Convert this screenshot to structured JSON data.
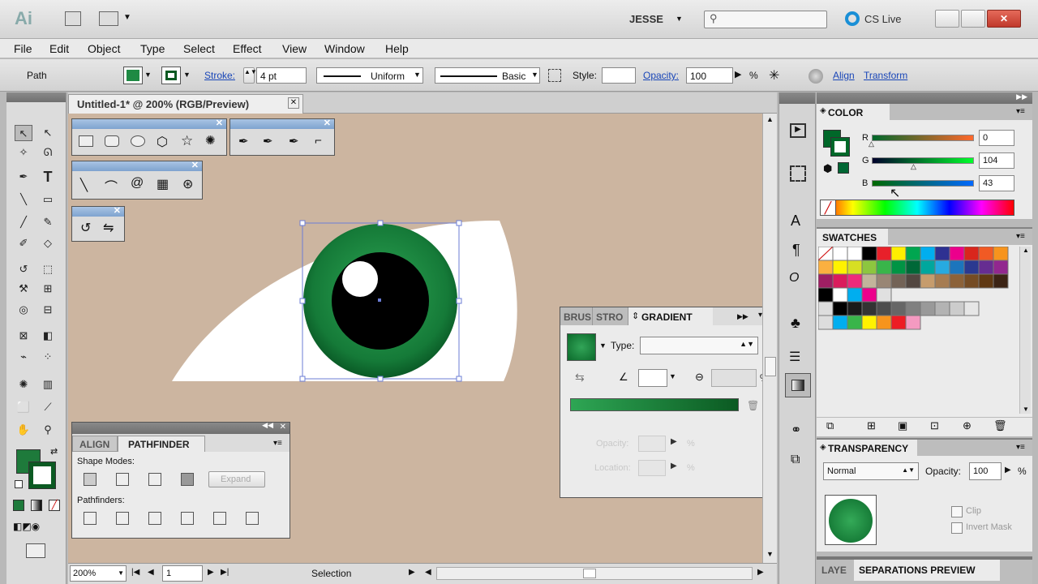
{
  "app": {
    "logo": "Ai",
    "user": "JESSE",
    "search_placeholder": "",
    "cslive": "CS Live"
  },
  "menu": [
    "File",
    "Edit",
    "Object",
    "Type",
    "Select",
    "Effect",
    "View",
    "Window",
    "Help"
  ],
  "control": {
    "selection_label": "Path",
    "stroke_label": "Stroke:",
    "stroke_value": "4 pt",
    "profile_label": "Uniform",
    "brush_label": "Basic",
    "style_label": "Style:",
    "opacity_label": "Opacity:",
    "opacity_value": "100",
    "percent": "%",
    "align_link": "Align",
    "transform_link": "Transform"
  },
  "document": {
    "tab_title": "Untitled-1* @ 200% (RGB/Preview)"
  },
  "status": {
    "zoom": "200%",
    "page": "1",
    "tool": "Selection"
  },
  "color_panel": {
    "title": "COLOR",
    "r_label": "R",
    "g_label": "G",
    "b_label": "B",
    "r": "0",
    "g": "104",
    "b": "43"
  },
  "swatches_panel": {
    "title": "SWATCHES"
  },
  "gradient_panel": {
    "tabs": [
      "BRUS",
      "STRO",
      "GRADIENT"
    ],
    "type_label": "Type:",
    "type_value": "",
    "opacity_label": "Opacity:",
    "location_label": "Location:",
    "percent": "%"
  },
  "align_panel": {
    "tabs": [
      "ALIGN",
      "PATHFINDER"
    ],
    "shape_modes": "Shape Modes:",
    "expand": "Expand",
    "pathfinders": "Pathfinders:"
  },
  "transparency_panel": {
    "title": "TRANSPARENCY",
    "mode": "Normal",
    "opacity_label": "Opacity:",
    "opacity_value": "100",
    "percent": "%",
    "clip": "Clip",
    "invert_mask": "Invert Mask"
  },
  "bottom_tabs": [
    "LAYE",
    "SEPARATIONS PREVIEW"
  ],
  "colors": {
    "canvas_bg": "#ccb5a0",
    "iris_outer": "#0f6b2f",
    "iris_inner": "#2a9a4a",
    "pupil": "#000000",
    "accent_green": "#00682b"
  }
}
